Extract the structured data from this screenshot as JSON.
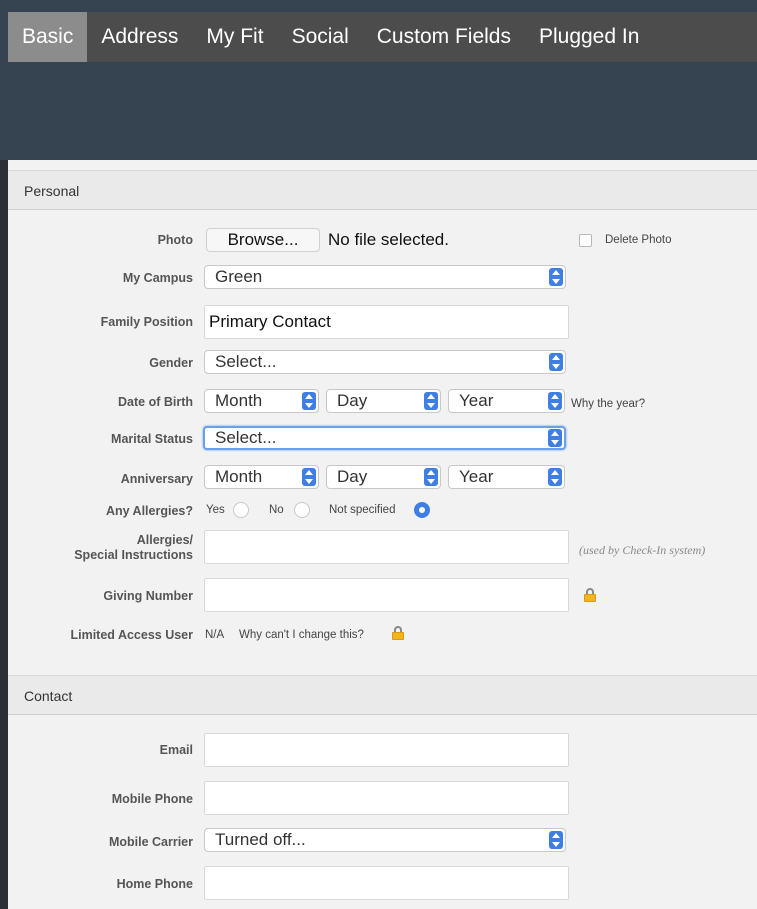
{
  "tabs": [
    "Basic",
    "Address",
    "My Fit",
    "Social",
    "Custom Fields",
    "Plugged In"
  ],
  "active_tab": "Basic",
  "personal": {
    "heading": "Personal",
    "photo": {
      "label": "Photo",
      "browse": "Browse...",
      "file_status": "No file selected.",
      "delete_label": "Delete Photo",
      "delete_checked": false
    },
    "campus": {
      "label": "My Campus",
      "value": "Green"
    },
    "family_position": {
      "label": "Family Position",
      "value": "Primary Contact"
    },
    "gender": {
      "label": "Gender",
      "value": "Select..."
    },
    "dob": {
      "label": "Date of Birth",
      "month": "Month",
      "day": "Day",
      "year": "Year",
      "hint": "Why the year?"
    },
    "marital": {
      "label": "Marital Status",
      "value": "Select..."
    },
    "anniversary": {
      "label": "Anniversary",
      "month": "Month",
      "day": "Day",
      "year": "Year"
    },
    "allergies": {
      "label": "Any Allergies?",
      "yes": "Yes",
      "no": "No",
      "not_specified": "Not specified",
      "selected": "Not specified"
    },
    "special": {
      "label_line1": "Allergies/",
      "label_line2": "Special Instructions",
      "value": "",
      "hint": "(used by Check-In system)"
    },
    "giving": {
      "label": "Giving Number",
      "value": ""
    },
    "limited": {
      "label": "Limited Access User",
      "value": "N/A",
      "why": "Why can't I change this?"
    }
  },
  "contact": {
    "heading": "Contact",
    "email": {
      "label": "Email",
      "value": ""
    },
    "mobile_phone": {
      "label": "Mobile Phone",
      "value": ""
    },
    "mobile_carrier": {
      "label": "Mobile Carrier",
      "value": "Turned off..."
    },
    "home_phone": {
      "label": "Home Phone",
      "value": ""
    }
  },
  "colors": {
    "accent": "#3f7fe4",
    "header_bg": "#364350",
    "tab_bar": "#4c4c4c",
    "tab_active": "#8c8c8c",
    "lock": "#f3b51d"
  }
}
